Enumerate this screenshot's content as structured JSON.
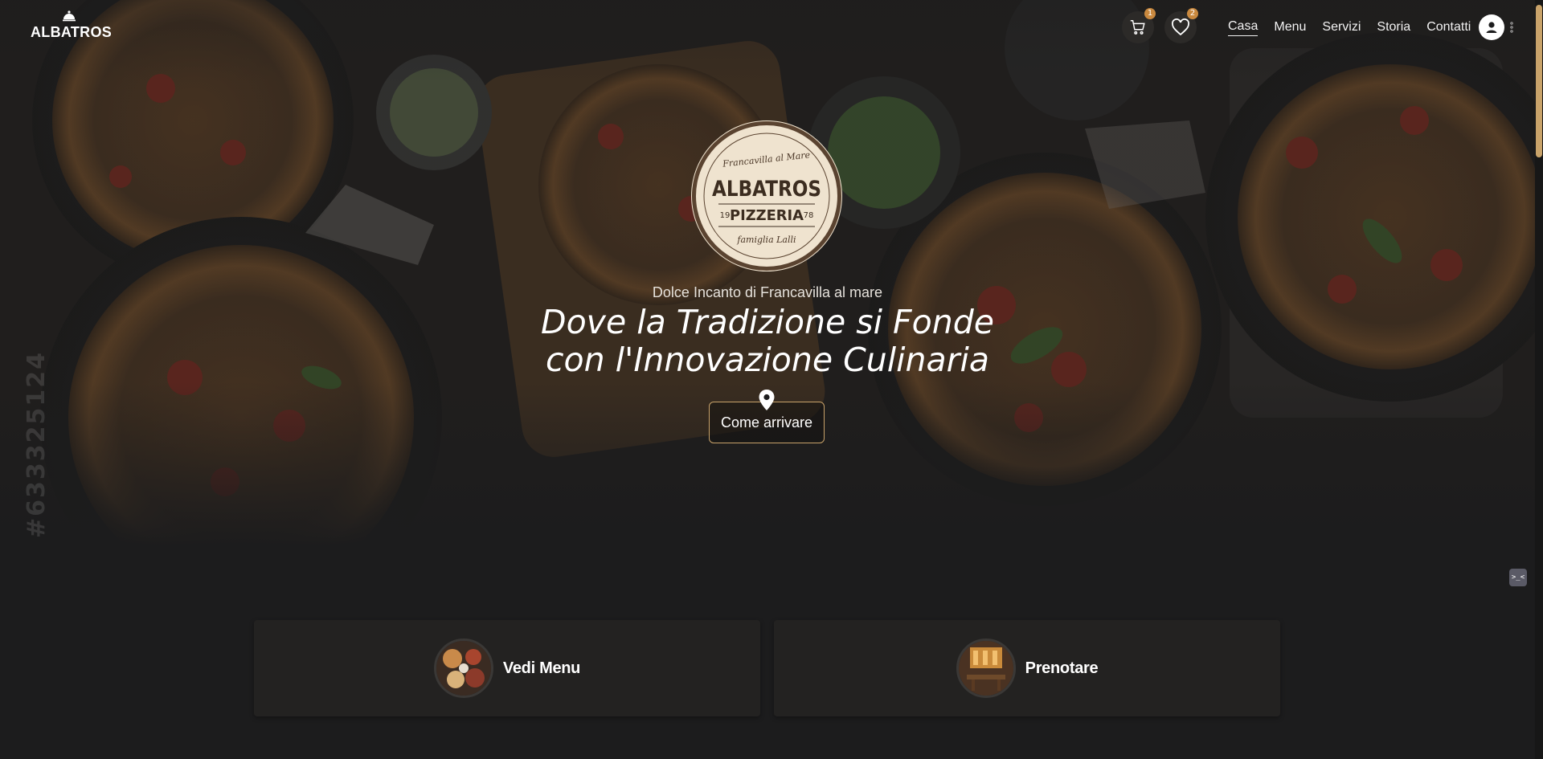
{
  "brand": {
    "name": "ALBATROS",
    "icon": "cloche-icon"
  },
  "header": {
    "cart": {
      "icon": "cart-icon",
      "count": "1"
    },
    "wishlist": {
      "icon": "heart-icon",
      "count": "2"
    },
    "nav": [
      {
        "label": "Casa",
        "active": true
      },
      {
        "label": "Menu",
        "active": false
      },
      {
        "label": "Servizi",
        "active": false
      },
      {
        "label": "Storia",
        "active": false
      },
      {
        "label": "Contatti",
        "active": false
      }
    ],
    "account_icon": "user-circle-icon",
    "more_icon": "kebab-icon"
  },
  "hero": {
    "watermark": "#633325124",
    "seal": {
      "top_text": "Francavilla al Mare",
      "name": "ALBATROS",
      "sub": "PIZZERIA",
      "year_left": "19",
      "year_right": "78",
      "bottom_text": "famiglia Lalli"
    },
    "tagline": "Dolce Incanto di Francavilla al mare",
    "headline_line1": "Dove la Tradizione si Fonde",
    "headline_line2": "con l'Innovazione Culinaria",
    "cta_label": "Come arrivare",
    "cta_icon": "map-pin-icon"
  },
  "cards": [
    {
      "label": "Vedi Menu",
      "icon": "menu-dishes-thumb"
    },
    {
      "label": "Prenotare",
      "icon": "restaurant-interior-thumb"
    }
  ],
  "floating": {
    "icon": "bot-icon",
    "text": ">_<"
  },
  "colors": {
    "accent": "#c9a36a",
    "badge": "#c9893f",
    "background": "#1c1c1d"
  }
}
